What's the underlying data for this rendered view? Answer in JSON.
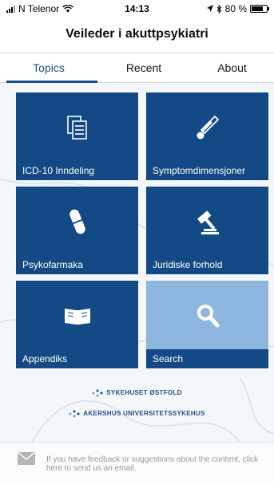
{
  "status_bar": {
    "carrier": "N Telenor",
    "time": "14:13",
    "battery": "80 %",
    "battery_level": 0.8,
    "icons": [
      "signal-icon",
      "wifi-icon",
      "location-icon",
      "bluetooth-icon",
      "battery-icon"
    ]
  },
  "app_title": "Veileder i akuttpsykiatri",
  "tabs": [
    {
      "label": "Topics",
      "active": true
    },
    {
      "label": "Recent",
      "active": false
    },
    {
      "label": "About",
      "active": false
    }
  ],
  "tiles": [
    {
      "label": "ICD-10 Inndeling",
      "icon": "document-icon"
    },
    {
      "label": "Symptomdimensjoner",
      "icon": "thermometer-icon"
    },
    {
      "label": "Psykofarmaka",
      "icon": "pill-icon"
    },
    {
      "label": "Juridiske forhold",
      "icon": "gavel-icon"
    },
    {
      "label": "Appendiks",
      "icon": "book-icon"
    },
    {
      "label": "Search",
      "icon": "search-icon"
    }
  ],
  "logos": [
    "SYKEHUSET ØSTFOLD",
    "AKERSHUS UNIVERSITETSSYKEHUS"
  ],
  "footer": {
    "text": "If you have feedback or suggestions about the content, click here to send us an email.",
    "icon": "mail-icon"
  },
  "colors": {
    "tile": "#134a85",
    "search_tile": "#8eb7e0",
    "accent": "#1d4f86"
  }
}
